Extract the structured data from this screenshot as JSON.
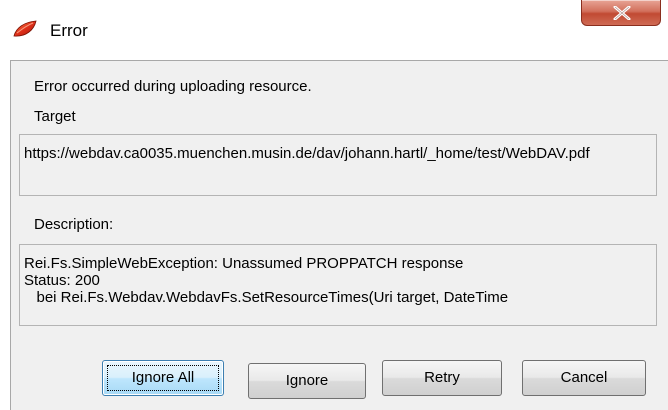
{
  "window": {
    "title": "Error"
  },
  "message": "Error occurred during uploading resource.",
  "target": {
    "label": "Target",
    "value": "https://webdav.ca0035.muenchen.musin.de/dav/johann.hartl/_home/test/WebDAV.pdf"
  },
  "description": {
    "label": "Description:",
    "lines": [
      "Rei.Fs.SimpleWebException: Unassumed PROPPATCH response",
      "Status: 200",
      "   bei Rei.Fs.Webdav.WebdavFs.SetResourceTimes(Uri target, DateTime"
    ]
  },
  "buttons": {
    "ignore_all": "Ignore All",
    "ignore": "Ignore",
    "retry": "Retry",
    "cancel": "Cancel"
  },
  "colors": {
    "close_button": "#c14a33",
    "default_button_border": "#3c7fb1",
    "client_background": "#f0f0f0"
  },
  "icons": {
    "app": "red-leaf-icon",
    "close": "close-icon"
  }
}
